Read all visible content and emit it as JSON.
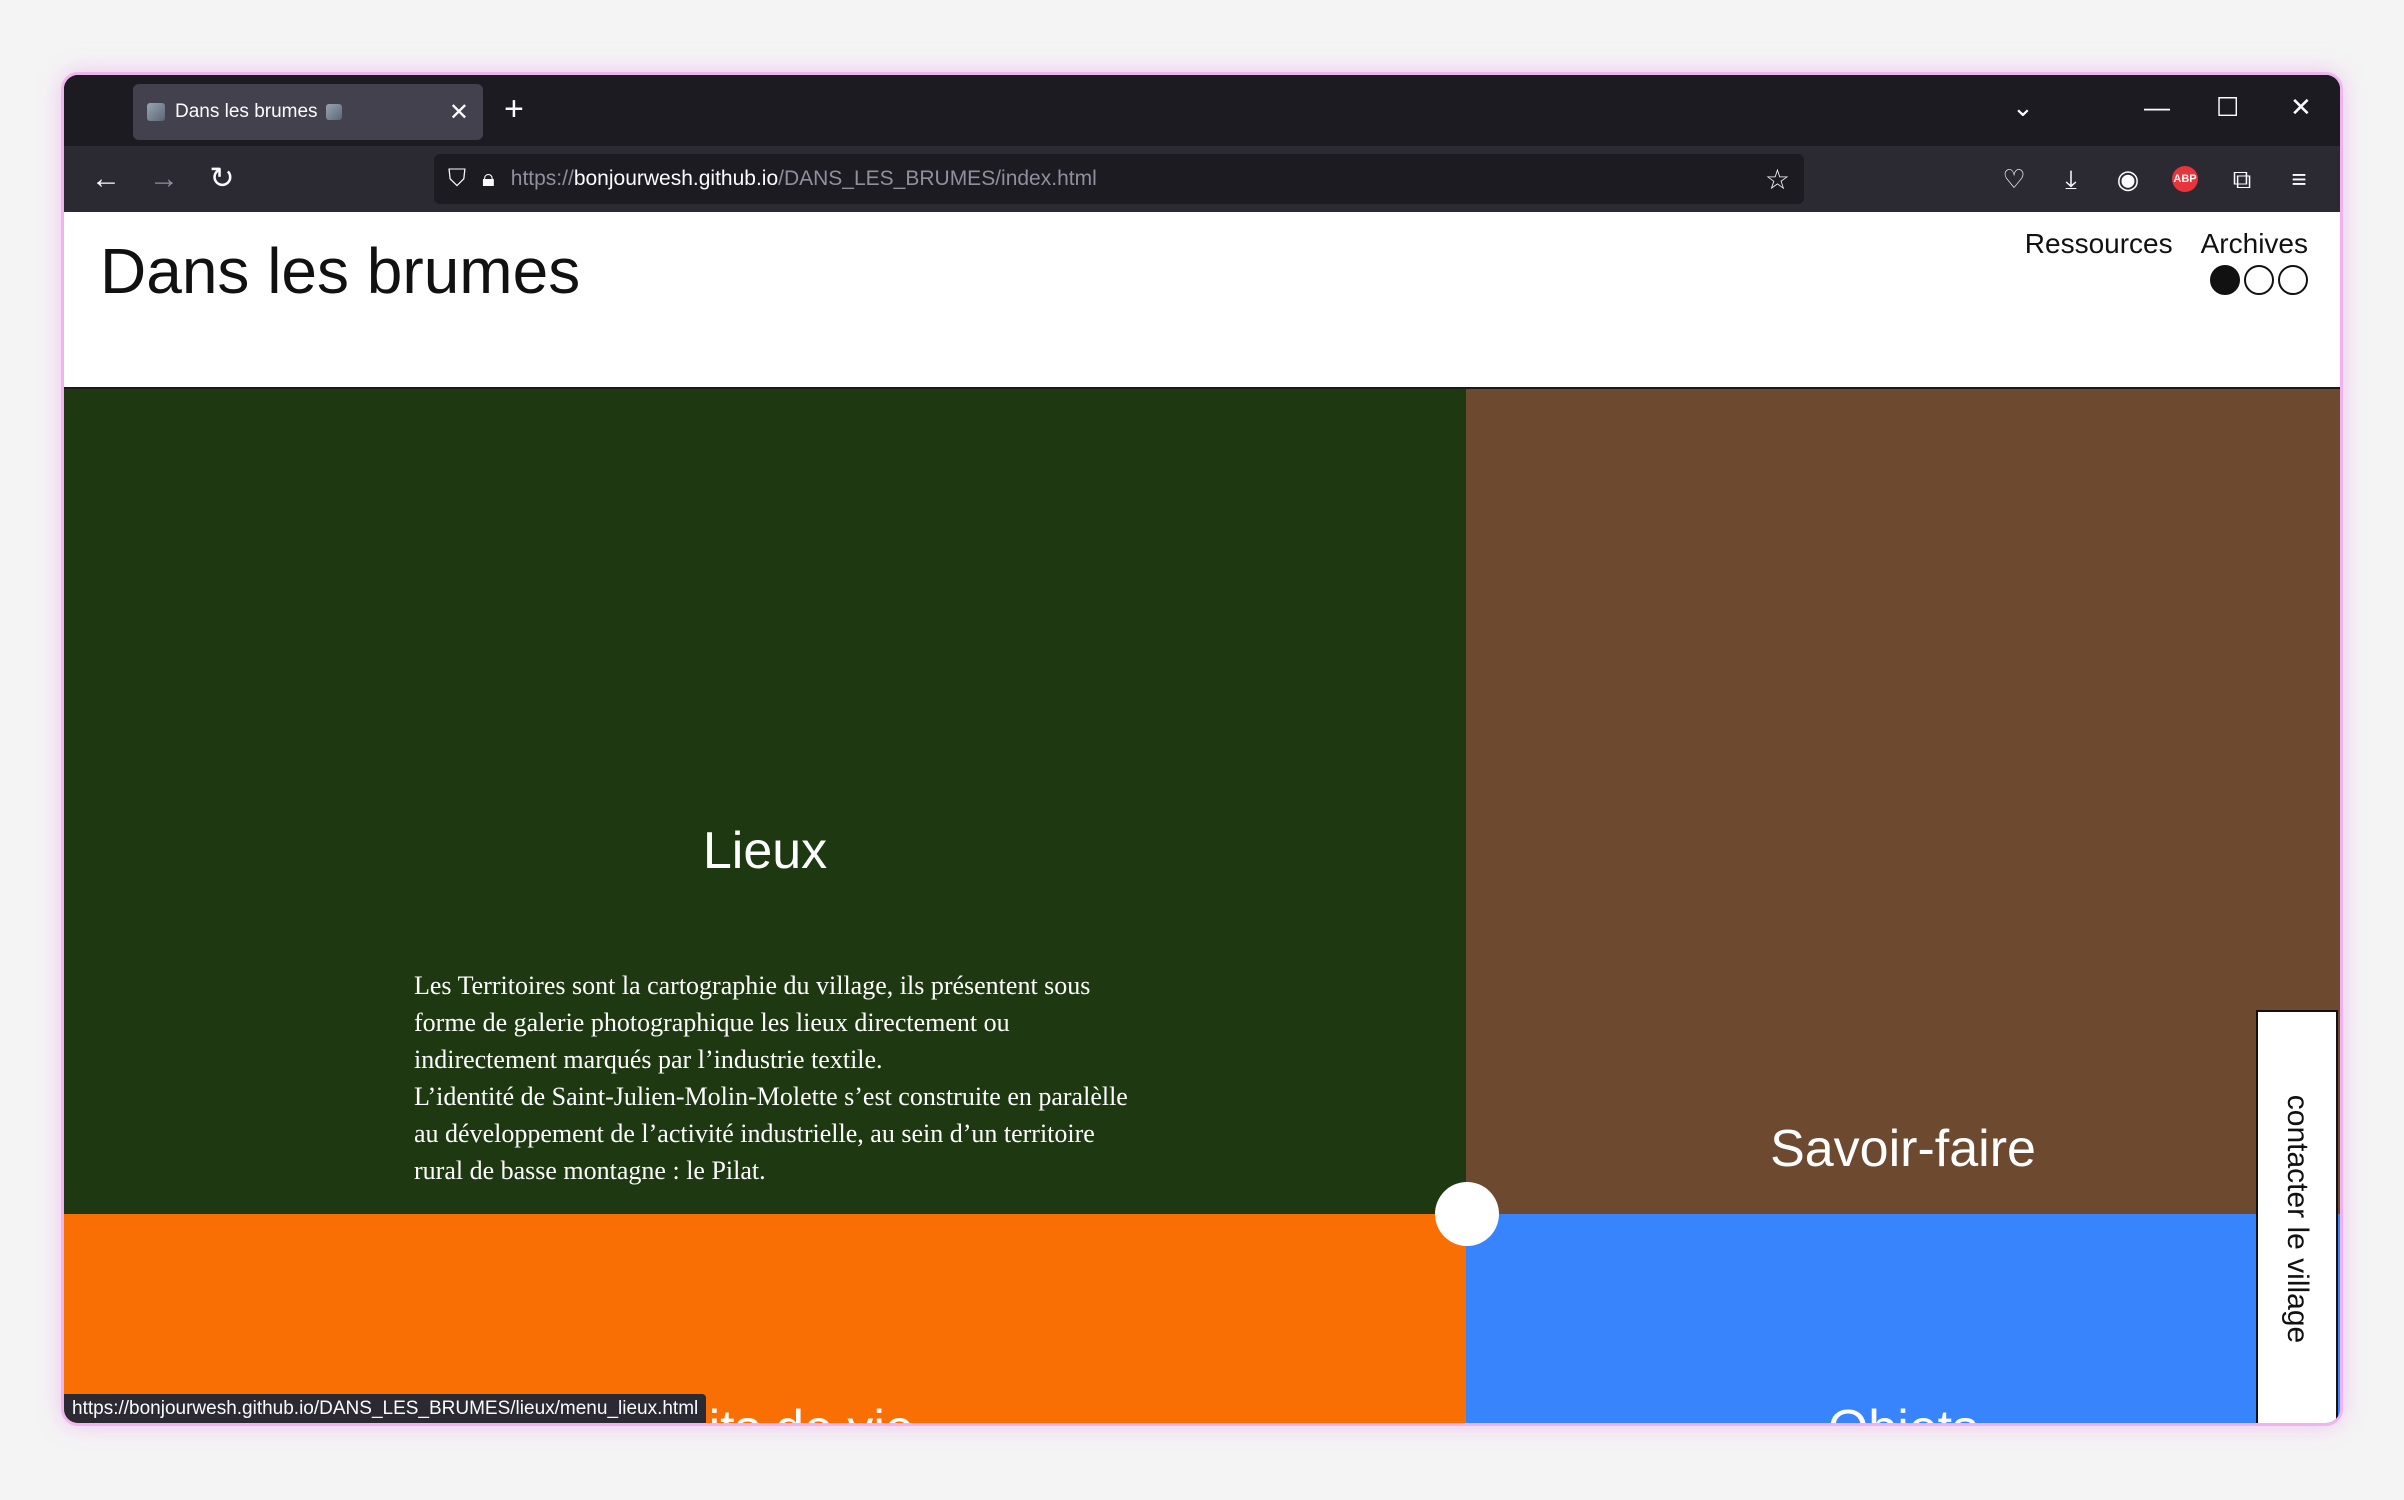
{
  "browser": {
    "tab_title": "Dans les brumes",
    "new_tab_icon": "plus",
    "url_scheme": "https://",
    "url_host": "bonjourwesh.github.io",
    "url_path": "/DANS_LES_BRUMES/index.html",
    "abp_label": "ABP",
    "status_url": "https://bonjourwesh.github.io/DANS_LES_BRUMES/lieux/menu_lieux.html"
  },
  "site": {
    "title": "Dans les brumes",
    "nav": [
      "Ressources",
      "Archives"
    ],
    "contact_label": "contacter le village"
  },
  "panels": {
    "lieux": {
      "title": "Lieux",
      "color": "#1e3812",
      "description": [
        "Les Territoires sont la cartographie du village, ils présentent sous forme de galerie photographique les lieux directement ou indirectement marqués par l’industrie textile.",
        "L’identité de Saint-Julien-Molin-Molette s’est construite en paralèlle au développement de l’activité industrielle, au sein d’un territoire rural de basse montagne : le Pilat."
      ]
    },
    "savoir_faire": {
      "title": "Savoir-faire",
      "color": "#6d4930"
    },
    "recits": {
      "title": "Récits de vie",
      "color": "#f96f03"
    },
    "objets": {
      "title": "Objets",
      "color": "#3884fd"
    }
  }
}
